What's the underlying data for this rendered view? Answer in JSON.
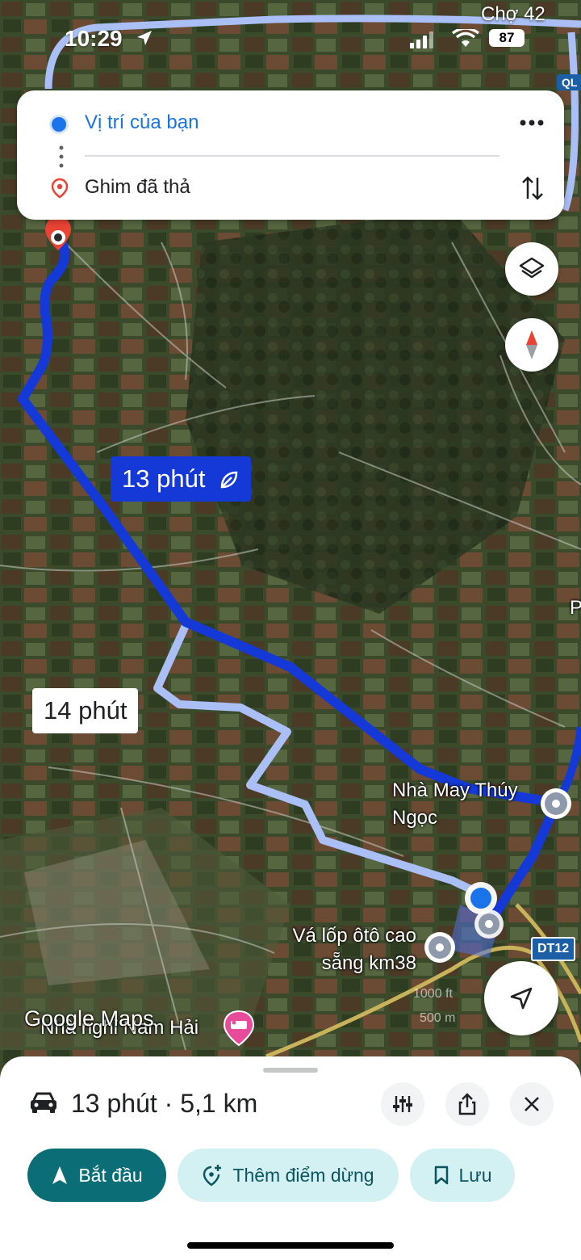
{
  "status_bar": {
    "time": "10:29",
    "battery": "87"
  },
  "map": {
    "top_label": "Chợ 42",
    "top_road_badge": "QL",
    "primary_route_time": "13 phút",
    "alt_route_time": "14 phút",
    "poi_factory": [
      "Nhà May Thúy",
      "Ngọc"
    ],
    "poi_tire": [
      "Vá lốp ôtô cao",
      "sẵng km38"
    ],
    "poi_hotel": "Nhà nghỉ Nam Hải",
    "road_badge": "DT12",
    "edge_label": "P",
    "scale_labels": [
      "1000 ft",
      "500 m"
    ],
    "attribution": "Google Maps"
  },
  "route_card": {
    "origin": "Vị trí của bạn",
    "destination": "Ghim đã thả"
  },
  "sheet": {
    "summary": "13 phút · 5,1 km",
    "start_label": "Bắt đầu",
    "add_stop_label": "Thêm điểm dừng",
    "save_label": "Lưu"
  },
  "colors": {
    "primary_route": "#1439d6",
    "alt_route": "#a9bff5",
    "accent_teal": "#0b6e76",
    "pill_light": "#d3f0f3",
    "origin_blue": "#1a73e8",
    "pin_red": "#ea4335"
  },
  "icons": [
    "location-arrow-icon",
    "cellular-signal-icon",
    "wifi-icon",
    "origin-dot-icon",
    "pin-icon",
    "more-icon",
    "swap-icon",
    "layers-icon",
    "compass-icon",
    "leaf-icon",
    "recenter-icon",
    "car-icon",
    "filters-icon",
    "share-icon",
    "close-icon",
    "navigate-icon",
    "add-stop-icon",
    "bookmark-icon",
    "hotel-icon"
  ]
}
